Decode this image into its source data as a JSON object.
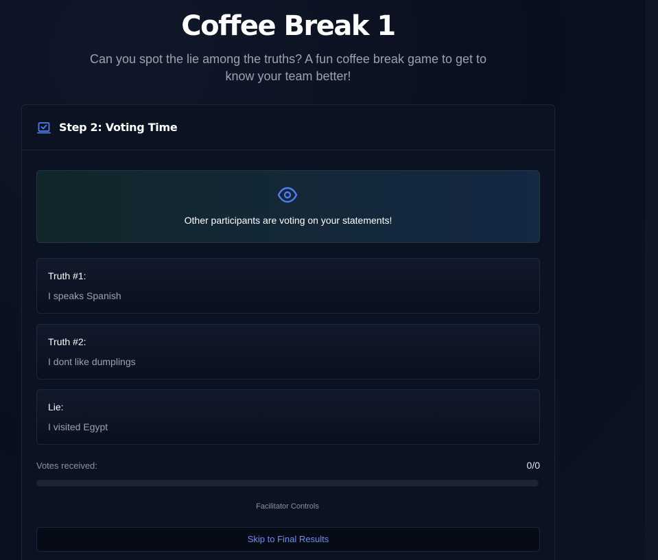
{
  "page": {
    "title": "Coffee Break 1",
    "subtitle": "Can you spot the lie among the truths? A fun coffee break game to get to know your team better!"
  },
  "step": {
    "icon": "vote-box-icon",
    "title": "Step 2: Voting Time"
  },
  "banner": {
    "icon": "eye-icon",
    "text": "Other participants are voting on your statements!"
  },
  "statements": [
    {
      "label": "Truth #1:",
      "text": "I speaks Spanish"
    },
    {
      "label": "Truth #2:",
      "text": "I dont like dumplings"
    },
    {
      "label": "Lie:",
      "text": "I visited Egypt"
    }
  ],
  "votes": {
    "label": "Votes received:",
    "count": "0/0",
    "progress_fraction": 0
  },
  "facilitator": {
    "label": "Facilitator Controls",
    "skip_button": "Skip to Final Results"
  },
  "colors": {
    "accent": "#3b82f6",
    "link": "#6d8ef0",
    "background": "#0b1120"
  }
}
